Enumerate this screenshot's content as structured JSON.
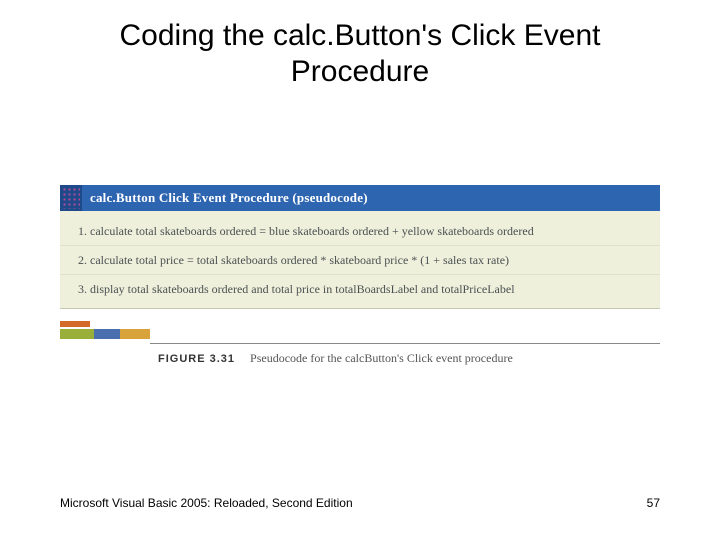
{
  "title": {
    "line1": "Coding the calc.Button's Click Event",
    "line2": "Procedure"
  },
  "figure": {
    "header": "calc.Button Click Event Procedure (pseudocode)",
    "steps": [
      "1. calculate total skateboards ordered = blue skateboards ordered + yellow skateboards ordered",
      "2. calculate total price = total skateboards ordered * skateboard price * (1 + sales tax rate)",
      "3. display total skateboards ordered and total price in totalBoardsLabel and totalPriceLabel"
    ],
    "caption_number": "FIGURE 3.31",
    "caption_text": "Pseudocode for the calcButton's Click event procedure"
  },
  "footer": {
    "left": "Microsoft Visual Basic 2005: Reloaded, Second Edition",
    "page": "57"
  }
}
